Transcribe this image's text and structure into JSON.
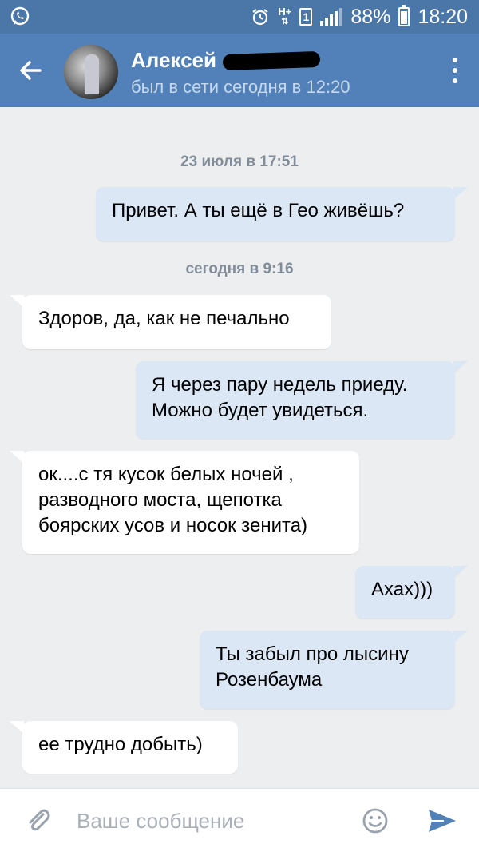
{
  "status_bar": {
    "battery_text": "88%",
    "battery_level": 0.88,
    "time": "18:20",
    "icons": [
      "whatsapp-icon",
      "alarm-icon",
      "data-hplus-icon",
      "sim-1-icon",
      "signal-icon",
      "battery-icon"
    ],
    "sim_label": "1",
    "network_label": "H+"
  },
  "header": {
    "contact_name": "Алексей",
    "last_seen": "был в сети сегодня в 12:20",
    "colors": {
      "bar": "#5181b8",
      "status": "#4a76a8"
    }
  },
  "messages": {
    "date_1": "23 июля в 17:51",
    "date_2": "сегодня в 9:16",
    "items": [
      {
        "dir": "out",
        "lines": [
          "Привет. А ты ещё в Гео живёшь?"
        ]
      },
      {
        "dir": "in",
        "lines": [
          "Здоров, да, как не печально"
        ]
      },
      {
        "dir": "out",
        "lines": [
          "Я через пару недель приеду.",
          "Можно будет увидеться."
        ]
      },
      {
        "dir": "in",
        "lines": [
          "ок....с тя кусок белых ночей ,",
          "разводного моста, щепотка",
          "боярских усов и носок зенита)"
        ]
      },
      {
        "dir": "out",
        "lines": [
          "Ахах)))"
        ]
      },
      {
        "dir": "out",
        "lines": [
          "Ты забыл про лысину",
          "Розенбаума"
        ]
      },
      {
        "dir": "in",
        "lines": [
          "ее трудно добыть)"
        ]
      }
    ],
    "colors": {
      "incoming": "#ffffff",
      "outgoing": "#dbe7f5",
      "background": "#edeef0"
    }
  },
  "composer": {
    "placeholder": "Ваше сообщение",
    "value": ""
  }
}
